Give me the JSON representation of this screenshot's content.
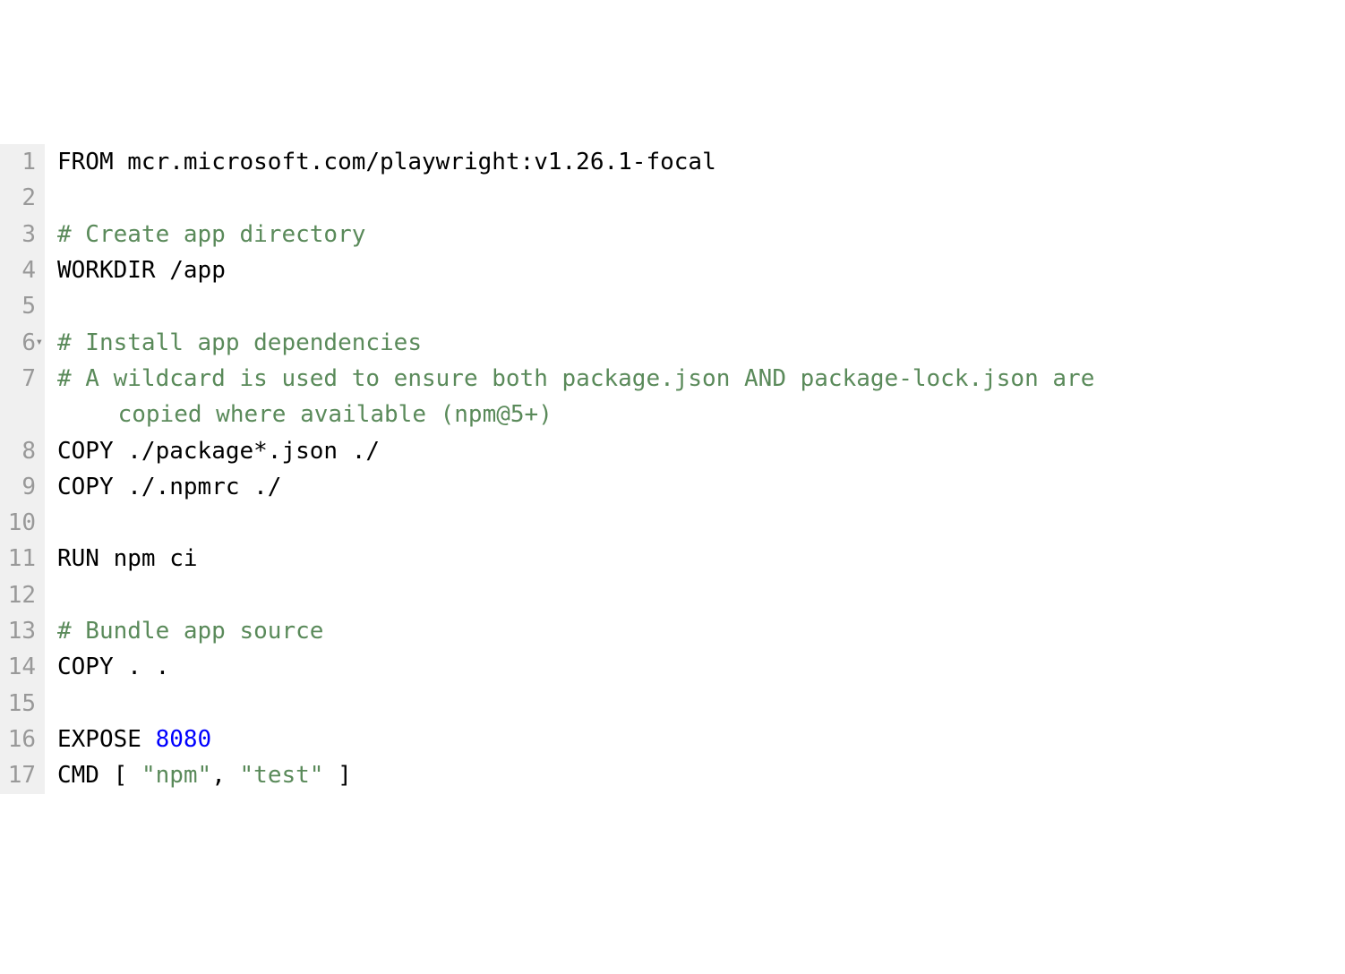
{
  "lines": [
    {
      "num": "1",
      "fold": false,
      "tokens": [
        {
          "cls": "tok-keyword",
          "text": "FROM"
        },
        {
          "cls": "tok-plain",
          "text": " mcr.microsoft.com/playwright:v1.26.1-focal"
        }
      ]
    },
    {
      "num": "2",
      "fold": false,
      "tokens": []
    },
    {
      "num": "3",
      "fold": false,
      "tokens": [
        {
          "cls": "tok-comment",
          "text": "# Create app directory"
        }
      ]
    },
    {
      "num": "4",
      "fold": false,
      "tokens": [
        {
          "cls": "tok-keyword",
          "text": "WORKDIR"
        },
        {
          "cls": "tok-plain",
          "text": " /app"
        }
      ]
    },
    {
      "num": "5",
      "fold": false,
      "tokens": []
    },
    {
      "num": "6",
      "fold": true,
      "tokens": [
        {
          "cls": "tok-comment",
          "text": "# Install app dependencies"
        }
      ]
    },
    {
      "num": "7",
      "fold": false,
      "wrap": true,
      "tokens": [
        {
          "cls": "tok-comment",
          "text": "# A wildcard is used to ensure both package.json AND package-lock.json are copied where available (npm@5+)"
        }
      ]
    },
    {
      "num": "8",
      "fold": false,
      "tokens": [
        {
          "cls": "tok-keyword",
          "text": "COPY"
        },
        {
          "cls": "tok-plain",
          "text": " ./package*.json ./"
        }
      ]
    },
    {
      "num": "9",
      "fold": false,
      "tokens": [
        {
          "cls": "tok-keyword",
          "text": "COPY"
        },
        {
          "cls": "tok-plain",
          "text": " ./.npmrc ./"
        }
      ]
    },
    {
      "num": "10",
      "fold": false,
      "tokens": []
    },
    {
      "num": "11",
      "fold": false,
      "tokens": [
        {
          "cls": "tok-keyword",
          "text": "RUN"
        },
        {
          "cls": "tok-plain",
          "text": " npm ci"
        }
      ]
    },
    {
      "num": "12",
      "fold": false,
      "tokens": []
    },
    {
      "num": "13",
      "fold": false,
      "tokens": [
        {
          "cls": "tok-comment",
          "text": "# Bundle app source"
        }
      ]
    },
    {
      "num": "14",
      "fold": false,
      "tokens": [
        {
          "cls": "tok-keyword",
          "text": "COPY"
        },
        {
          "cls": "tok-plain",
          "text": " . ."
        }
      ]
    },
    {
      "num": "15",
      "fold": false,
      "tokens": []
    },
    {
      "num": "16",
      "fold": false,
      "tokens": [
        {
          "cls": "tok-keyword",
          "text": "EXPOSE"
        },
        {
          "cls": "tok-plain",
          "text": " "
        },
        {
          "cls": "tok-number",
          "text": "8080"
        }
      ]
    },
    {
      "num": "17",
      "fold": false,
      "tokens": [
        {
          "cls": "tok-keyword",
          "text": "CMD"
        },
        {
          "cls": "tok-plain",
          "text": " "
        },
        {
          "cls": "tok-punct",
          "text": "[ "
        },
        {
          "cls": "tok-string",
          "text": "\"npm\""
        },
        {
          "cls": "tok-punct",
          "text": ", "
        },
        {
          "cls": "tok-string",
          "text": "\"test\""
        },
        {
          "cls": "tok-punct",
          "text": " ]"
        }
      ]
    }
  ]
}
